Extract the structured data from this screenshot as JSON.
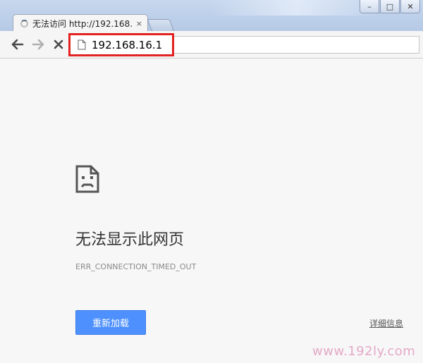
{
  "window": {
    "minimize_symbol": "–",
    "maximize_symbol": "□",
    "close_symbol": "✕"
  },
  "tab": {
    "title": "无法访问 http://192.168.",
    "close_symbol": "×"
  },
  "toolbar": {
    "back_icon": "arrow-left-icon",
    "forward_icon": "arrow-right-icon",
    "stop_icon": "close-icon",
    "address_value": "192.168.16.1"
  },
  "error_page": {
    "icon": "sad-page-icon",
    "title": "无法显示此网页",
    "code": "ERR_CONNECTION_TIMED_OUT",
    "reload_label": "重新加载",
    "details_label": "详细信息"
  },
  "watermark": "www.192ly.com",
  "colors": {
    "accent": "#4d90fe",
    "highlight_border": "#e32222",
    "watermark": "#e3a9c8"
  }
}
